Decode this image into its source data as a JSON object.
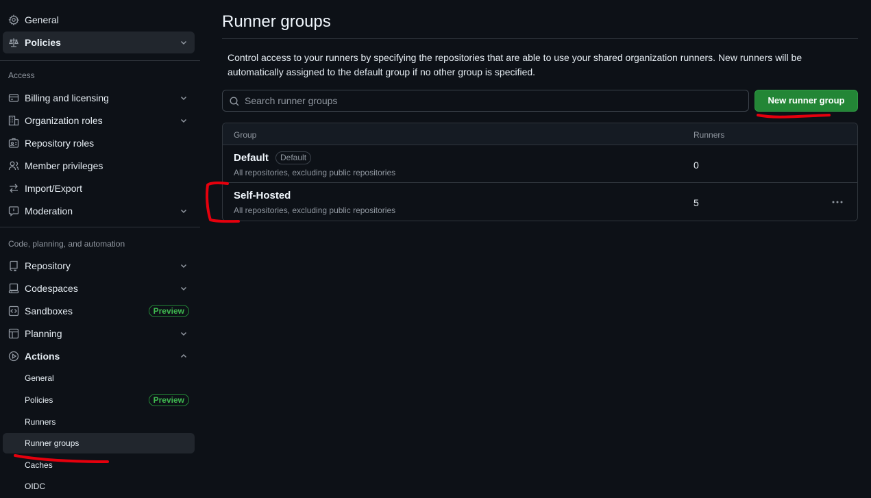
{
  "sidebar": {
    "top_items": [
      {
        "label": "General",
        "icon": "gear-icon"
      },
      {
        "label": "Policies",
        "icon": "law-icon"
      }
    ],
    "access_heading": "Access",
    "access_items": [
      {
        "label": "Billing and licensing",
        "icon": "credit-card-icon"
      },
      {
        "label": "Organization roles",
        "icon": "organization-icon"
      },
      {
        "label": "Repository roles",
        "icon": "id-badge-icon"
      },
      {
        "label": "Member privileges",
        "icon": "person-icon"
      },
      {
        "label": "Import/Export",
        "icon": "arrow-switch-icon"
      },
      {
        "label": "Moderation",
        "icon": "report-icon"
      }
    ],
    "code_heading": "Code, planning, and automation",
    "code_items": [
      {
        "label": "Repository",
        "icon": "repo-icon"
      },
      {
        "label": "Codespaces",
        "icon": "codespaces-icon"
      },
      {
        "label": "Sandboxes",
        "icon": "code-square-icon",
        "badge": "Preview"
      },
      {
        "label": "Planning",
        "icon": "table-icon"
      },
      {
        "label": "Actions",
        "icon": "play-icon"
      }
    ],
    "actions_sub": [
      {
        "label": "General"
      },
      {
        "label": "Policies",
        "badge": "Preview"
      },
      {
        "label": "Runners"
      },
      {
        "label": "Runner groups"
      },
      {
        "label": "Caches"
      },
      {
        "label": "OIDC"
      }
    ]
  },
  "main": {
    "title": "Runner groups",
    "description": "Control access to your runners by specifying the repositories that are able to use your shared organization runners. New runners will be automatically assigned to the default group if no other group is specified.",
    "search_placeholder": "Search runner groups",
    "new_button": "New runner group",
    "table": {
      "col_group": "Group",
      "col_runners": "Runners",
      "rows": [
        {
          "name": "Default",
          "badge": "Default",
          "access": "All repositories, excluding public repositories",
          "runners": "0"
        },
        {
          "name": "Self-Hosted",
          "access": "All repositories, excluding public repositories",
          "runners": "5"
        }
      ]
    }
  },
  "colors": {
    "background": "#0d1117",
    "primary_button": "#238636",
    "annotation": "#e5000d"
  }
}
